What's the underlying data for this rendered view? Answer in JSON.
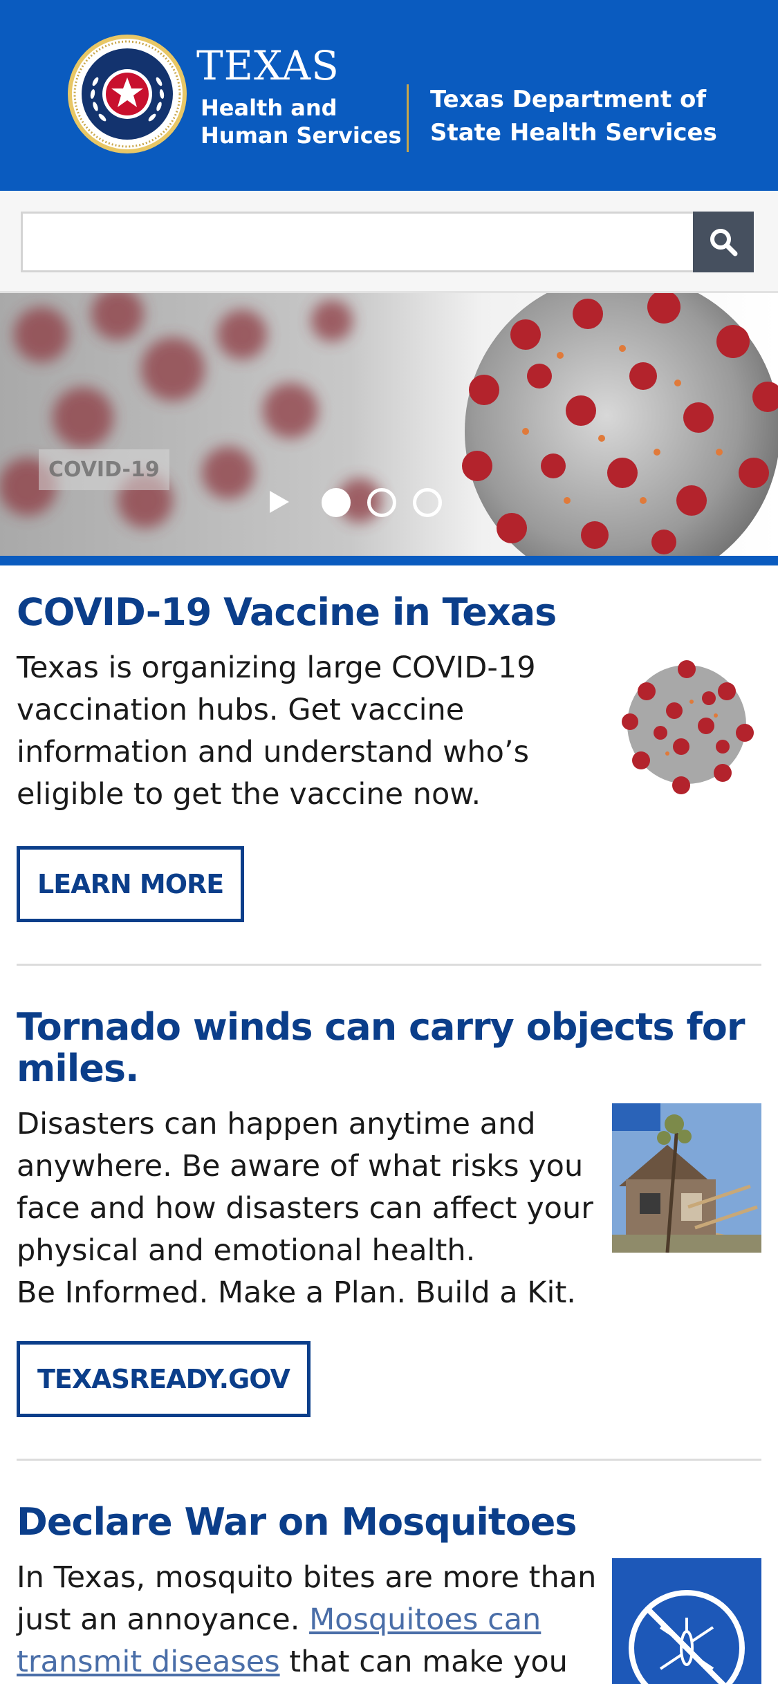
{
  "header": {
    "logo_texas": "TEXAS",
    "logo_hhs": "Health and Human Services",
    "logo_dshs": "Texas Department of State Health Services",
    "brand_color": "#0a5bbf",
    "gold_color": "#c9a64a"
  },
  "search": {
    "value": "",
    "placeholder": "",
    "icon": "search-icon"
  },
  "carousel": {
    "caption": "COVID-19",
    "slides_total": 3,
    "active_slide": 1
  },
  "articles": [
    {
      "title": "COVID-19 Vaccine in Texas",
      "body": "Texas is organizing large COVID-19 vaccination hubs. Get vaccine information and understand who’s eligible to get the vaccine now.",
      "button": "LEARN MORE",
      "thumbnail": "coronavirus-image"
    },
    {
      "title": "Tornado winds can carry objects for miles.",
      "body": "Disasters can happen anytime and anywhere. Be aware of what risks you face and how disasters can affect your physical and emotional health.",
      "body_line2": "Be Informed. Make a Plan. Build a Kit.",
      "button": "TEXASREADY.GOV",
      "thumbnail": "tornado-damage-photo"
    },
    {
      "title": "Declare War on Mosquitoes",
      "body_start": "In Texas, mosquito bites are more than just an annoyance. ",
      "body_link": "Mosquitoes can transmit diseases",
      "body_end": " that can make you and",
      "thumbnail": "no-mosquito-icon"
    }
  ],
  "colors": {
    "heading": "#0b3e8a",
    "link": "#4a6ea8",
    "search_button": "#46505f"
  }
}
